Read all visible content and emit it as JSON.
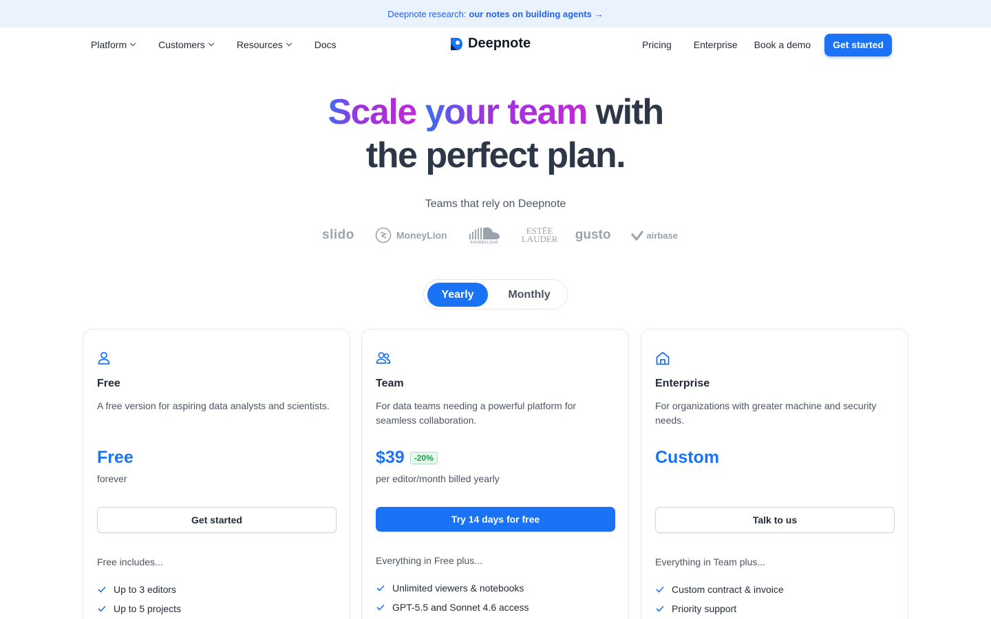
{
  "banner": {
    "prefix": "Deepnote research:",
    "link": "our notes on building agents",
    "arrow": "→"
  },
  "nav": {
    "left": [
      "Platform",
      "Customers",
      "Resources",
      "Docs"
    ],
    "logo": "Deepnote",
    "right": [
      "Pricing",
      "Enterprise",
      "Book a demo"
    ],
    "cta": "Get started"
  },
  "hero": {
    "grad1": "Scale",
    "grad2": "your team",
    "rest1": "with",
    "line2": "the perfect plan."
  },
  "teams": {
    "title": "Teams that rely on Deepnote",
    "logos": [
      "slido",
      "MoneyLion",
      "SOUNDCLOUD",
      "ESTĒE LAUDER",
      "gusto",
      "airbase"
    ]
  },
  "billing": {
    "yearly": "Yearly",
    "monthly": "Monthly",
    "selected": "Yearly"
  },
  "plans": [
    {
      "icon": "user-icon",
      "name": "Free",
      "desc": "A free version for aspiring data analysts and scientists.",
      "price": "Free",
      "sub": "forever",
      "button": "Get started",
      "includes": "Free includes...",
      "features": [
        "Up to 3 editors",
        "Up to 5 projects"
      ]
    },
    {
      "icon": "users-icon",
      "name": "Team",
      "desc": "For data teams needing a powerful platform for seamless collaboration.",
      "price": "$39",
      "badge": "-20%",
      "sub": "per editor/month billed yearly",
      "button": "Try 14 days for free",
      "includes": "Everything in Free plus...",
      "features": [
        "Unlimited viewers & notebooks",
        "GPT-5.5 and Sonnet 4.6 access"
      ]
    },
    {
      "icon": "home-icon",
      "name": "Enterprise",
      "desc": "For organizations with greater machine and security needs.",
      "price": "Custom",
      "sub": "",
      "button": "Talk to us",
      "includes": "Everything in Team plus...",
      "features": [
        "Custom contract & invoice",
        "Priority support"
      ]
    }
  ],
  "colors": {
    "accent": "#1a73f5",
    "banner_bg": "#eaf2fd",
    "badge_green": "#16a34a"
  }
}
